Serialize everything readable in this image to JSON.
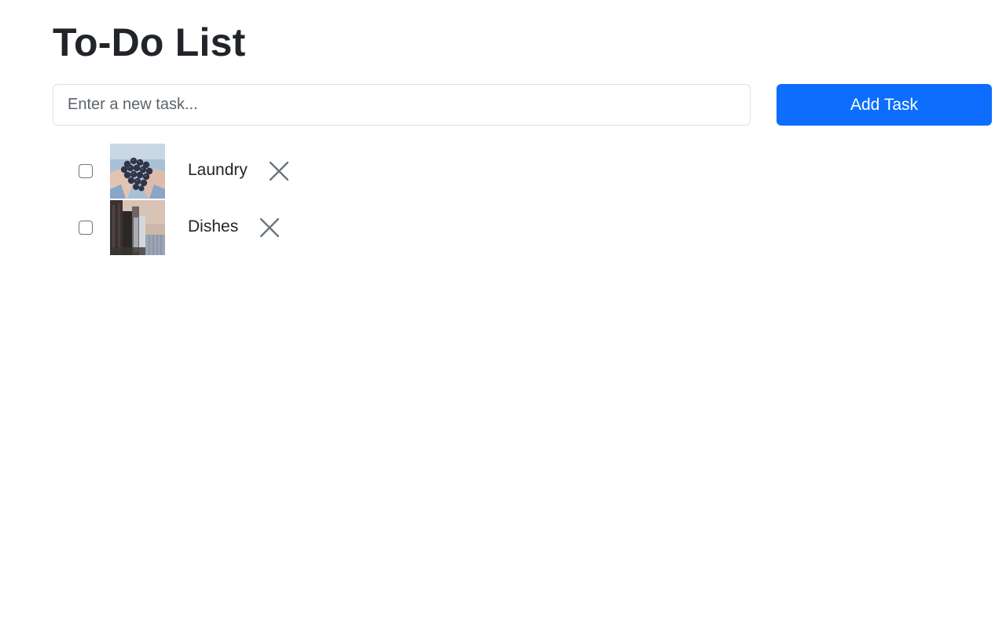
{
  "page": {
    "title": "To-Do List"
  },
  "form": {
    "placeholder": "Enter a new task...",
    "value": "",
    "add_label": "Add Task"
  },
  "tasks": [
    {
      "label": "Laundry",
      "checked": false,
      "image": "grapes-in-hands-photo",
      "delete_icon": "close-icon"
    },
    {
      "label": "Dishes",
      "checked": false,
      "image": "city-buildings-photo",
      "delete_icon": "close-icon"
    }
  ],
  "colors": {
    "accent": "#0d6efd",
    "text": "#212529",
    "border": "#dee2e6",
    "icon": "#6c757d"
  }
}
